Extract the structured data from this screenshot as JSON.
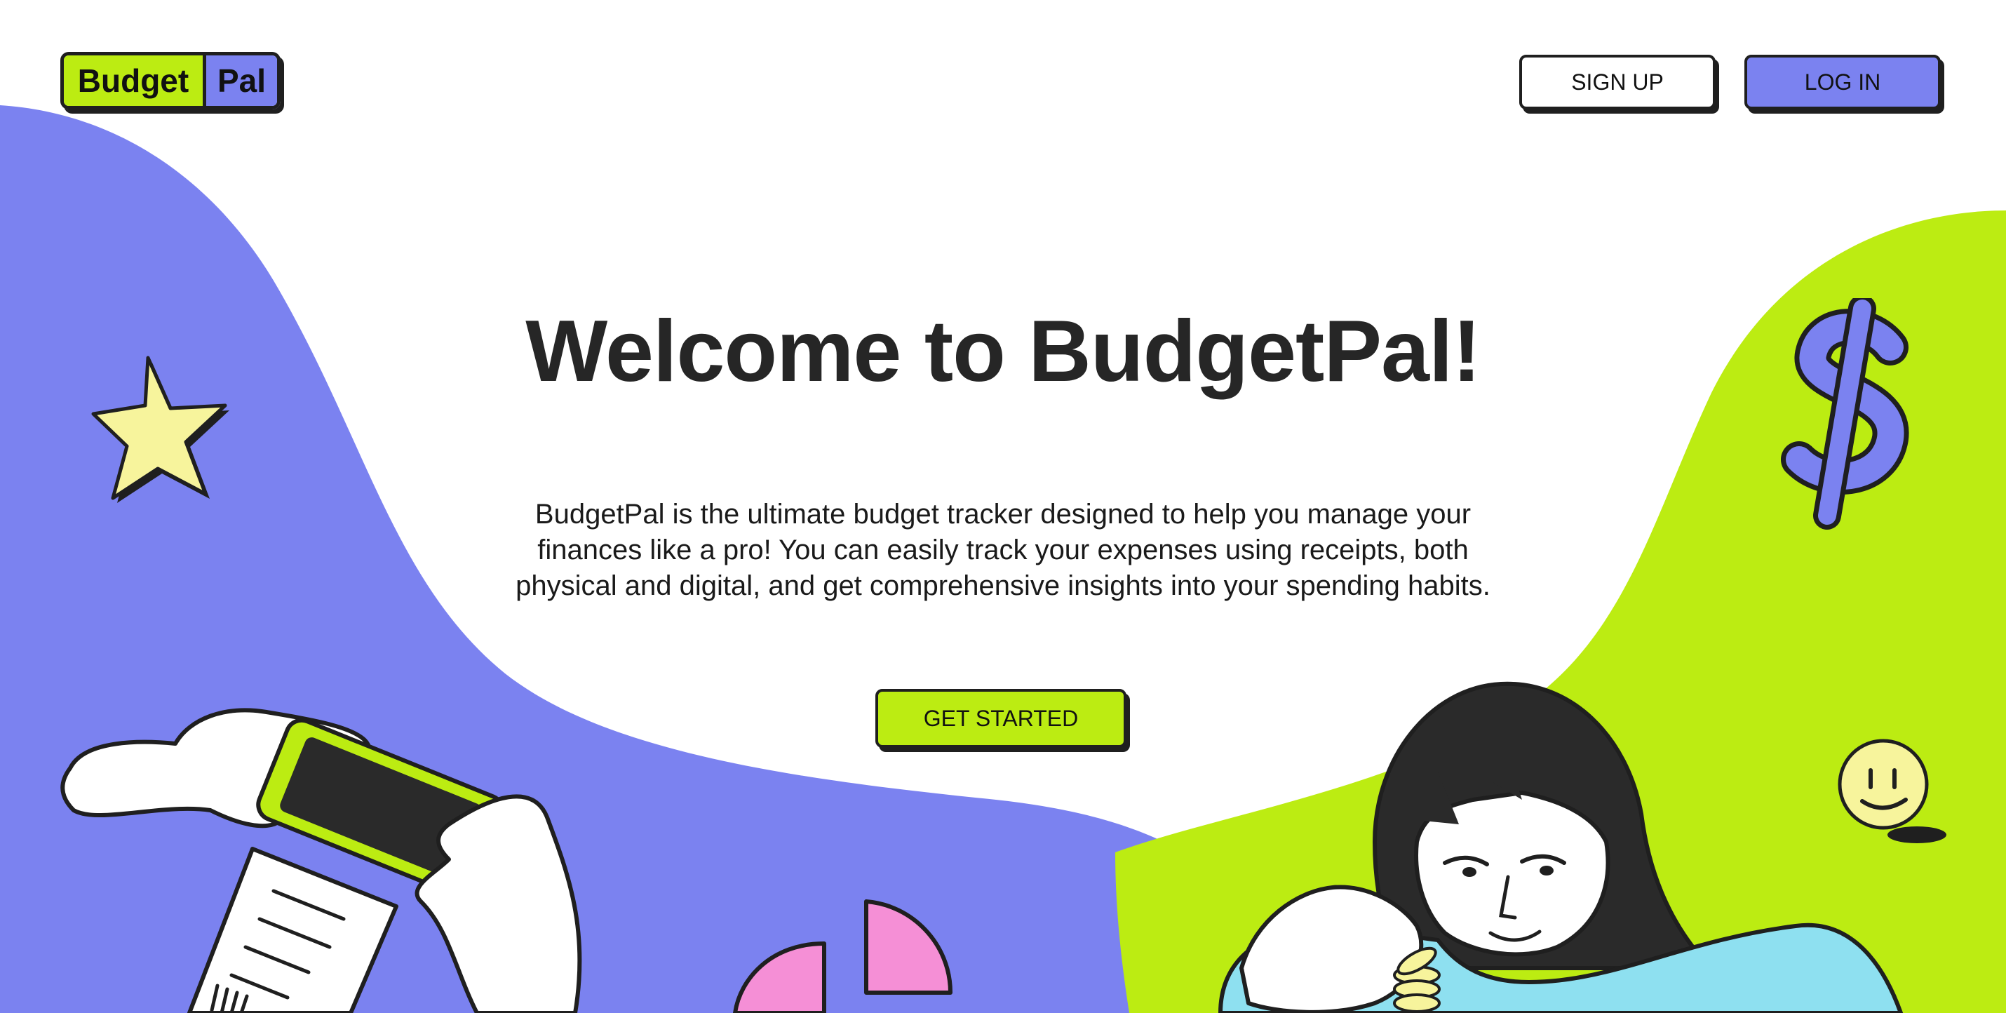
{
  "header": {
    "logo": {
      "part1": "Budget",
      "part2": "Pal"
    },
    "signup_label": "SIGN UP",
    "login_label": "LOG IN"
  },
  "hero": {
    "headline": "Welcome to BudgetPal!",
    "description": "BudgetPal is the ultimate budget tracker designed to help you manage your finances like a pro! You can easily track your expenses using receipts, both physical and digital, and get comprehensive insights into your spending habits.",
    "cta_label": "GET STARTED"
  },
  "icons": [
    "star-icon",
    "dollar-sign-icon",
    "smiley-icon",
    "phone-in-hands-illustration",
    "receipt-illustration",
    "pie-chart-illustration",
    "girl-with-coins-illustration"
  ],
  "colors": {
    "brand_purple": "#7b82f0",
    "brand_lime": "#bcec12",
    "ink": "#1f1f1f",
    "star_yellow": "#f7f49c",
    "pie_pink": "#f58fd6",
    "shirt_blue": "#8ee0f0"
  }
}
